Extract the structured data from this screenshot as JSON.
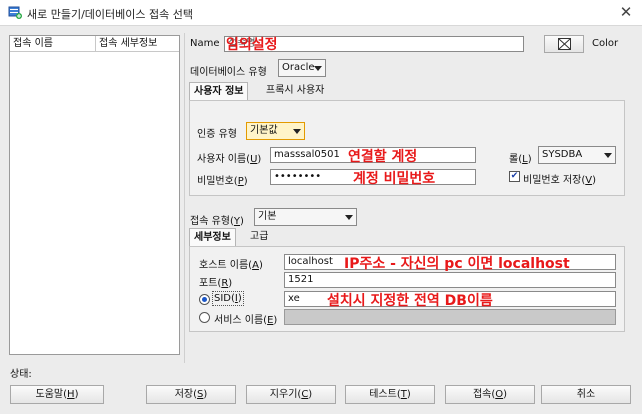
{
  "window": {
    "title": "새로 만들기/데이터베이스 접속 선택",
    "close_glyph": "✕"
  },
  "connections": {
    "col_name": "접속 이름",
    "col_detail": "접속 세부정보"
  },
  "name": {
    "label": "Name",
    "value": "접속명",
    "annotation": "임의설정",
    "color_label": "Color"
  },
  "db_type": {
    "label": "데이터베이스 유형",
    "value": "Oracle"
  },
  "user_tabs": [
    {
      "label": "사용자 정보",
      "active": true
    },
    {
      "label": "프록시 사용자",
      "active": false
    }
  ],
  "auth": {
    "label": "인증 유형",
    "value": "기본값"
  },
  "username": {
    "label_pre": "사용자 이름(",
    "key": "U",
    "label_post": ")",
    "value": "masssal0501",
    "annotation": "연결할 계정"
  },
  "role": {
    "label_pre": "롤(",
    "key": "L",
    "label_post": ")",
    "value": "SYSDBA"
  },
  "password": {
    "label_pre": "비밀번호(",
    "key": "P",
    "label_post": ")",
    "value": "••••••••",
    "annotation": "계정 비밀번호"
  },
  "save_password": {
    "label_pre": "비밀번호 저장(",
    "key": "V",
    "label_post": ")",
    "checked": true
  },
  "conn_type": {
    "label_pre": "접속 유형(",
    "key": "Y",
    "label_post": ")",
    "value": "기본"
  },
  "detail_tabs": [
    {
      "label": "세부정보",
      "active": true
    },
    {
      "label": "고급",
      "active": false
    }
  ],
  "host": {
    "label_pre": "호스트 이름(",
    "key": "A",
    "label_post": ")",
    "value": "localhost",
    "annotation": "IP주소 - 자신의 pc 이면 localhost"
  },
  "port": {
    "label_pre": "포트(",
    "key": "R",
    "label_post": ")",
    "value": "1521"
  },
  "sid": {
    "label_pre": "SID(",
    "key": "I",
    "label_post": ")",
    "value": "xe",
    "annotation": "설치시 지정한 전역 DB이름",
    "selected": true
  },
  "service": {
    "label_pre": "서비스 이름(",
    "key": "E",
    "label_post": ")",
    "value": ""
  },
  "status": {
    "label": "상태:"
  },
  "buttons": {
    "help": {
      "pre": "도움말(",
      "key": "H",
      "post": ")"
    },
    "save": {
      "pre": "저장(",
      "key": "S",
      "post": ")"
    },
    "clear": {
      "pre": "지우기(",
      "key": "C",
      "post": ")"
    },
    "test": {
      "pre": "테스트(",
      "key": "T",
      "post": ")"
    },
    "connect": {
      "pre": "접속(",
      "key": "O",
      "post": ")"
    },
    "cancel": {
      "label": "취소"
    }
  }
}
